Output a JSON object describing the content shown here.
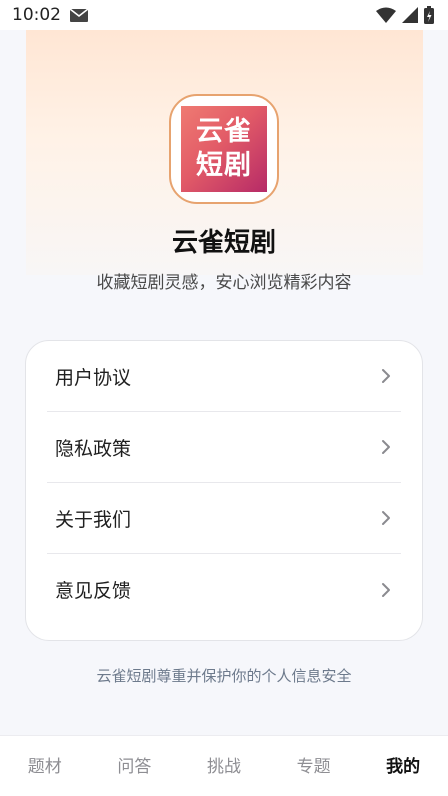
{
  "status_bar": {
    "time": "10:02",
    "icons": [
      "mail-icon",
      "wifi-icon",
      "signal-icon",
      "battery-icon"
    ]
  },
  "app": {
    "icon_line1": "云雀",
    "icon_line2": "短剧",
    "name": "云雀短剧",
    "tagline": "收藏短剧灵感，安心浏览精彩内容"
  },
  "menu": {
    "items": [
      {
        "label": "用户协议"
      },
      {
        "label": "隐私政策"
      },
      {
        "label": "关于我们"
      },
      {
        "label": "意见反馈"
      }
    ]
  },
  "footer_note": "云雀短剧尊重并保护你的个人信息安全",
  "nav": {
    "tabs": [
      {
        "label": "题材"
      },
      {
        "label": "问答"
      },
      {
        "label": "挑战"
      },
      {
        "label": "专题"
      },
      {
        "label": "我的"
      }
    ],
    "active": "我的"
  },
  "colors": {
    "accent_orange": "#e7a36f",
    "icon_gradient_start": "#ef7a72",
    "icon_gradient_end": "#b62a67",
    "muted_text": "#6d7a8c"
  }
}
